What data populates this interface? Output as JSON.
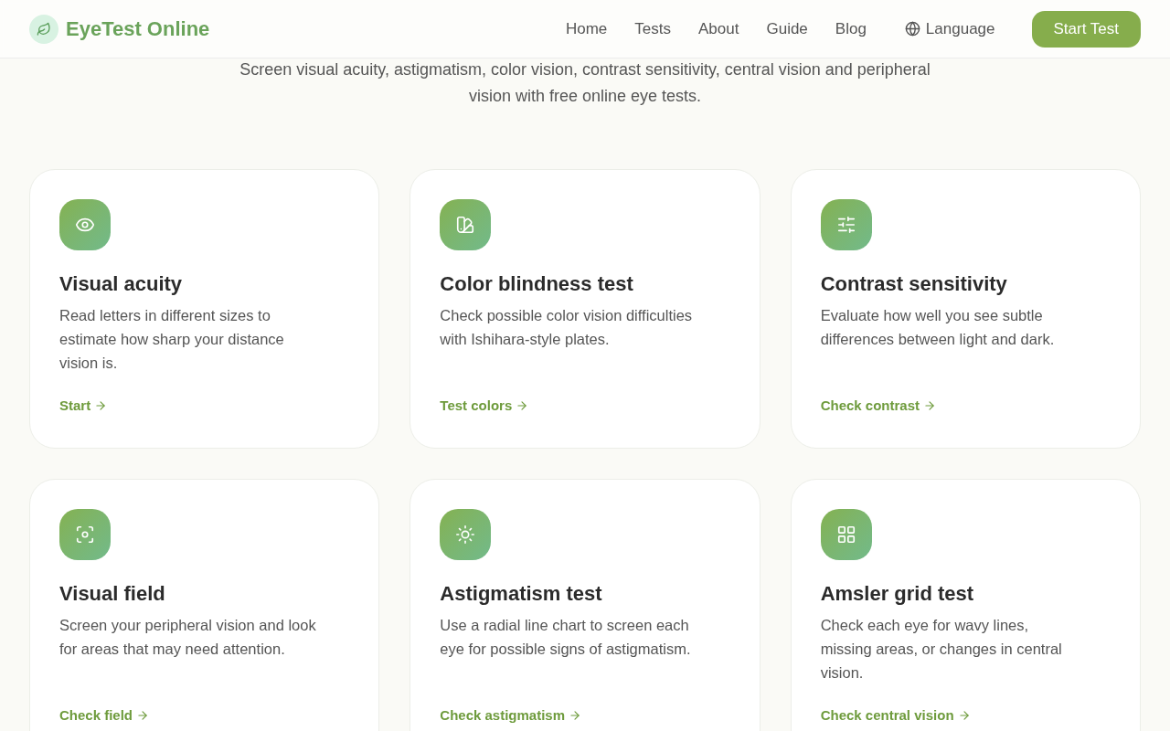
{
  "header": {
    "logo": "EyeTest Online",
    "nav": [
      {
        "label": "Home",
        "kind": "link"
      },
      {
        "label": "Tests",
        "kind": "link"
      },
      {
        "label": "About",
        "kind": "link"
      },
      {
        "label": "Guide",
        "kind": "link"
      },
      {
        "label": "Blog",
        "kind": "link"
      },
      {
        "label": "Language",
        "kind": "language"
      }
    ],
    "cta": "Start Test"
  },
  "hero": {
    "subtitle": "Screen visual acuity, astigmatism, color vision, contrast sensitivity, central vision and peripheral vision with free online eye tests."
  },
  "cards": [
    {
      "kind": "eye",
      "title": "Visual acuity",
      "text": "Read letters in different sizes to estimate how sharp your distance vision is.",
      "link": "Start"
    },
    {
      "kind": "swatch",
      "title": "Color blindness test",
      "text": "Check possible color vision difficulties with Ishihara-style plates.",
      "link": "Test colors"
    },
    {
      "kind": "sliders",
      "title": "Contrast sensitivity",
      "text": "Evaluate how well you see subtle differences between light and dark.",
      "link": "Check contrast"
    },
    {
      "kind": "focus",
      "title": "Visual field",
      "text": "Screen your peripheral vision and look for areas that may need attention.",
      "link": "Check field"
    },
    {
      "kind": "sun",
      "title": "Astigmatism test",
      "text": "Use a radial line chart to screen each eye for possible signs of astigmatism.",
      "link": "Check astigmatism"
    },
    {
      "kind": "grid",
      "title": "Amsler grid test",
      "text": "Check each eye for wavy lines, missing areas, or changes in central vision.",
      "link": "Check central vision"
    }
  ]
}
